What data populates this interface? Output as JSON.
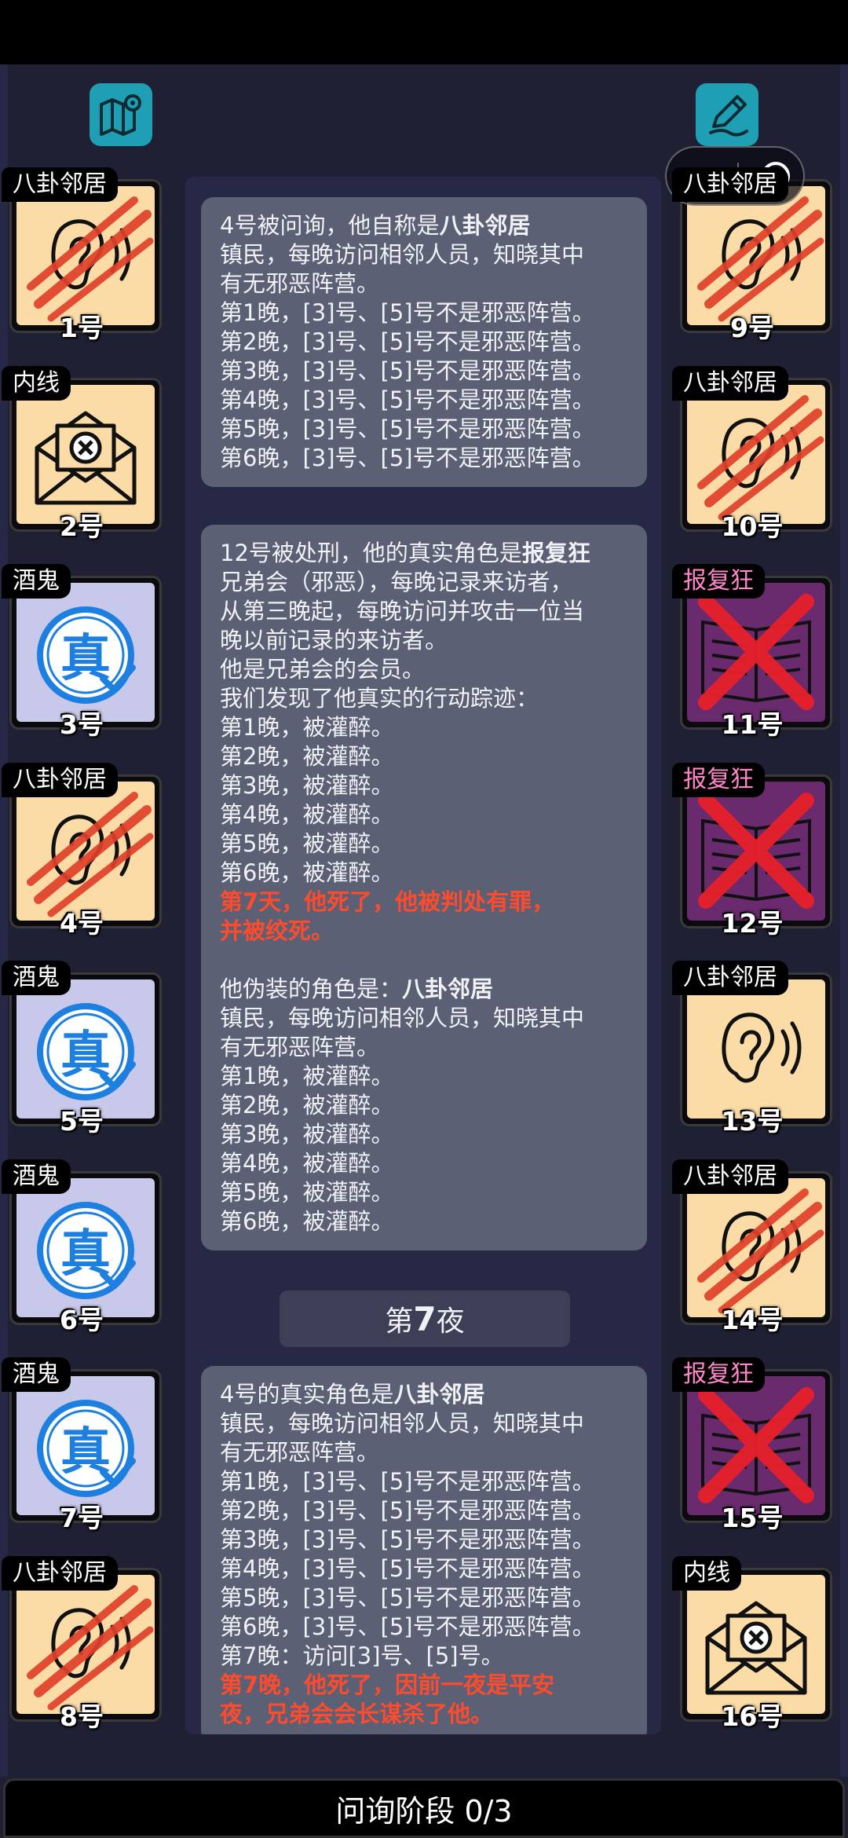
{
  "phase_label": "问询阶段 0/3",
  "night_divider": {
    "prefix": "第",
    "number": "7",
    "suffix": "夜"
  },
  "left_cards": [
    {
      "role": "八卦邻居",
      "number": "1号",
      "state": "slashed",
      "face": "ear"
    },
    {
      "role": "内线",
      "number": "2号",
      "state": "normal",
      "face": "envelope"
    },
    {
      "role": "酒鬼",
      "number": "3号",
      "state": "normal",
      "face": "stamp"
    },
    {
      "role": "八卦邻居",
      "number": "4号",
      "state": "slashed",
      "face": "ear"
    },
    {
      "role": "酒鬼",
      "number": "5号",
      "state": "normal",
      "face": "stamp"
    },
    {
      "role": "酒鬼",
      "number": "6号",
      "state": "normal",
      "face": "stamp"
    },
    {
      "role": "酒鬼",
      "number": "7号",
      "state": "normal",
      "face": "stamp"
    },
    {
      "role": "八卦邻居",
      "number": "8号",
      "state": "slashed",
      "face": "ear"
    }
  ],
  "right_cards": [
    {
      "role": "八卦邻居",
      "number": "9号",
      "state": "slashed",
      "face": "ear"
    },
    {
      "role": "八卦邻居",
      "number": "10号",
      "state": "slashed",
      "face": "ear"
    },
    {
      "role": "报复狂",
      "number": "11号",
      "state": "executed",
      "face": "book"
    },
    {
      "role": "报复狂",
      "number": "12号",
      "state": "executed",
      "face": "book"
    },
    {
      "role": "八卦邻居",
      "number": "13号",
      "state": "normal",
      "face": "ear"
    },
    {
      "role": "八卦邻居",
      "number": "14号",
      "state": "slashed",
      "face": "ear"
    },
    {
      "role": "报复狂",
      "number": "15号",
      "state": "executed",
      "face": "book"
    },
    {
      "role": "内线",
      "number": "16号",
      "state": "normal",
      "face": "envelope"
    }
  ],
  "messages": [
    {
      "lines": [
        {
          "pre": "4号被问询，他自称是",
          "bold": "八卦邻居"
        },
        {
          "text": "镇民，每晚访问相邻人员，知晓其中"
        },
        {
          "text": "有无邪恶阵营。"
        },
        {
          "text": "第1晚，[3]号、[5]号不是邪恶阵营。"
        },
        {
          "text": "第2晚，[3]号、[5]号不是邪恶阵营。"
        },
        {
          "text": "第3晚，[3]号、[5]号不是邪恶阵营。"
        },
        {
          "text": "第4晚，[3]号、[5]号不是邪恶阵营。"
        },
        {
          "text": "第5晚，[3]号、[5]号不是邪恶阵营。"
        },
        {
          "text": "第6晚，[3]号、[5]号不是邪恶阵营。"
        }
      ]
    },
    {
      "lines": [
        {
          "pre": "12号被处刑，他的真实角色是",
          "bold": "报复狂"
        },
        {
          "text": "兄弟会（邪恶），每晚记录来访者，"
        },
        {
          "text": "从第三晚起，每晚访问并攻击一位当"
        },
        {
          "text": "晚以前记录的来访者。"
        },
        {
          "text": "他是兄弟会的会员。"
        },
        {
          "text": "我们发现了他真实的行动踪迹："
        },
        {
          "text": "第1晚，被灌醉。"
        },
        {
          "text": "第2晚，被灌醉。"
        },
        {
          "text": "第3晚，被灌醉。"
        },
        {
          "text": "第4晚，被灌醉。"
        },
        {
          "text": "第5晚，被灌醉。"
        },
        {
          "text": "第6晚，被灌醉。"
        },
        {
          "red": "第7天，他死了，他被判处有罪，"
        },
        {
          "red": "并被绞死。"
        },
        {
          "blank": true
        },
        {
          "pre": "他伪装的角色是：",
          "bold": "八卦邻居"
        },
        {
          "text": "镇民，每晚访问相邻人员，知晓其中"
        },
        {
          "text": "有无邪恶阵营。"
        },
        {
          "text": "第1晚，被灌醉。"
        },
        {
          "text": "第2晚，被灌醉。"
        },
        {
          "text": "第3晚，被灌醉。"
        },
        {
          "text": "第4晚，被灌醉。"
        },
        {
          "text": "第5晚，被灌醉。"
        },
        {
          "text": "第6晚，被灌醉。"
        }
      ]
    },
    {
      "lines": [
        {
          "pre": "4号的真实角色是",
          "bold": "八卦邻居"
        },
        {
          "text": "镇民，每晚访问相邻人员，知晓其中"
        },
        {
          "text": "有无邪恶阵营。"
        },
        {
          "text": "第1晚，[3]号、[5]号不是邪恶阵营。"
        },
        {
          "text": "第2晚，[3]号、[5]号不是邪恶阵营。"
        },
        {
          "text": "第3晚，[3]号、[5]号不是邪恶阵营。"
        },
        {
          "text": "第4晚，[3]号、[5]号不是邪恶阵营。"
        },
        {
          "text": "第5晚，[3]号、[5]号不是邪恶阵营。"
        },
        {
          "text": "第6晚，[3]号、[5]号不是邪恶阵营。"
        },
        {
          "text": "第7晚：访问[3]号、[5]号。"
        },
        {
          "red": "第7晚，他死了，因前一夜是平安"
        },
        {
          "red": "夜，兄弟会会长谋杀了他。"
        }
      ]
    }
  ],
  "colors": {
    "card_cream": "#fbdca6",
    "card_lavender": "#c7c8ea",
    "card_purple": "#6a2a6e",
    "slash_red": "#e0402a",
    "cross_red": "#e8202a",
    "stamp_blue": "#1d7fe0",
    "icon_teal": "#1f9fb4"
  }
}
